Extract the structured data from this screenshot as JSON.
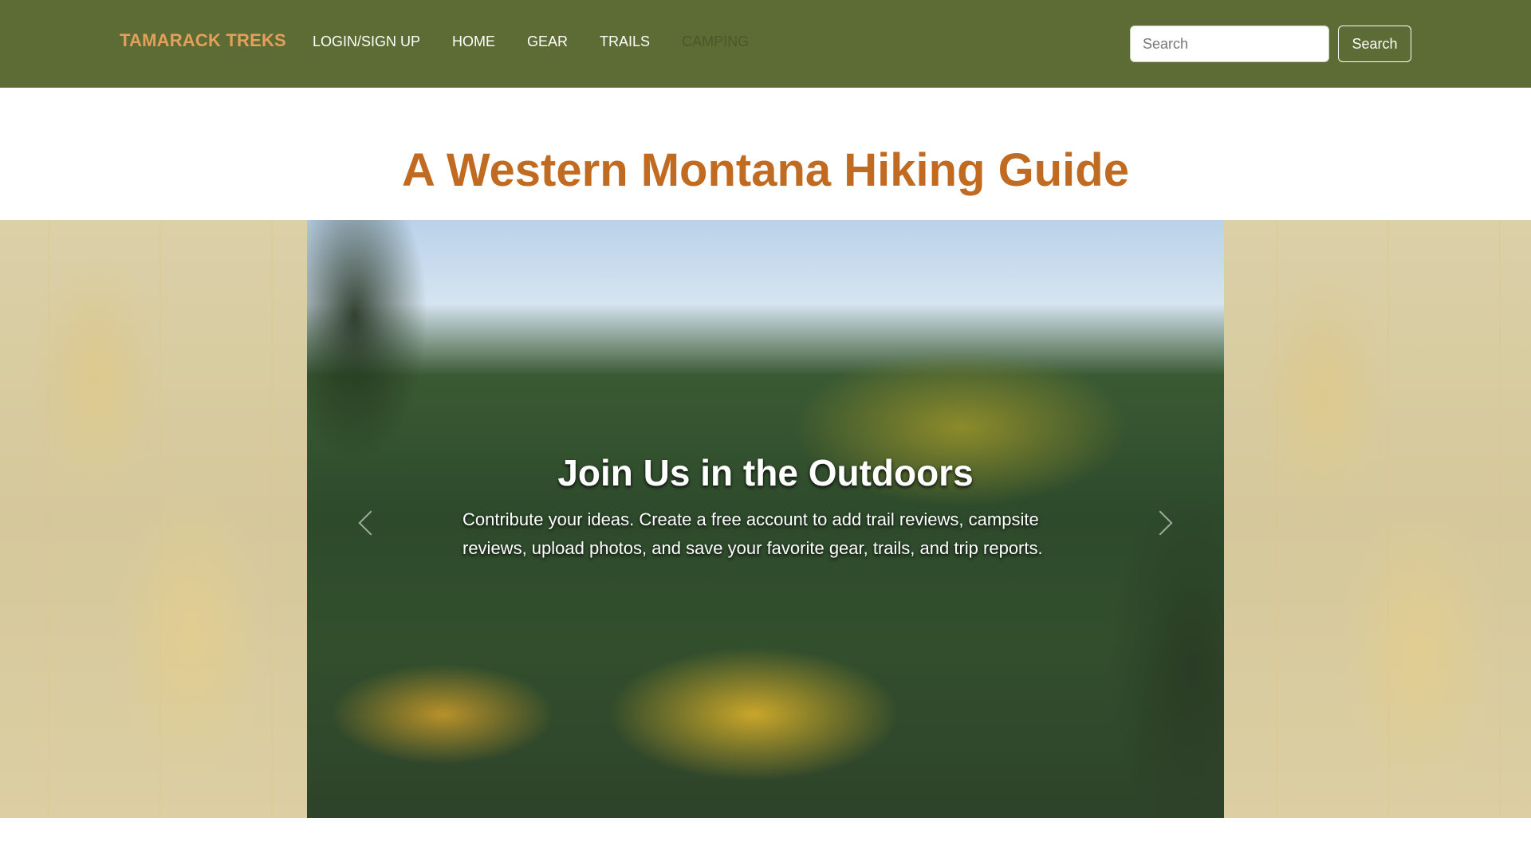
{
  "navbar": {
    "brand": "TAMARACK TREKS",
    "links": [
      {
        "label": "LOGIN/SIGN UP",
        "disabled": false
      },
      {
        "label": "HOME",
        "disabled": false
      },
      {
        "label": "GEAR",
        "disabled": false
      },
      {
        "label": "TRAILS",
        "disabled": false
      },
      {
        "label": "CAMPING",
        "disabled": true
      }
    ],
    "search": {
      "placeholder": "Search",
      "value": "",
      "button_label": "Search"
    }
  },
  "main": {
    "title": "A Western Montana Hiking Guide"
  },
  "carousel": {
    "caption_title": "Join Us in the Outdoors",
    "caption_text": "Contribute your ideas. Create a free account to add trail reviews, campsite reviews, upload photos, and save your favorite gear, trails, and trip reports.",
    "prev_icon": "chevron-left-icon",
    "next_icon": "chevron-right-icon"
  },
  "colors": {
    "navbar_bg": "#5d6b34",
    "brand": "#e3a05b",
    "title": "#c16b22",
    "disabled_link": "#4b5828"
  }
}
